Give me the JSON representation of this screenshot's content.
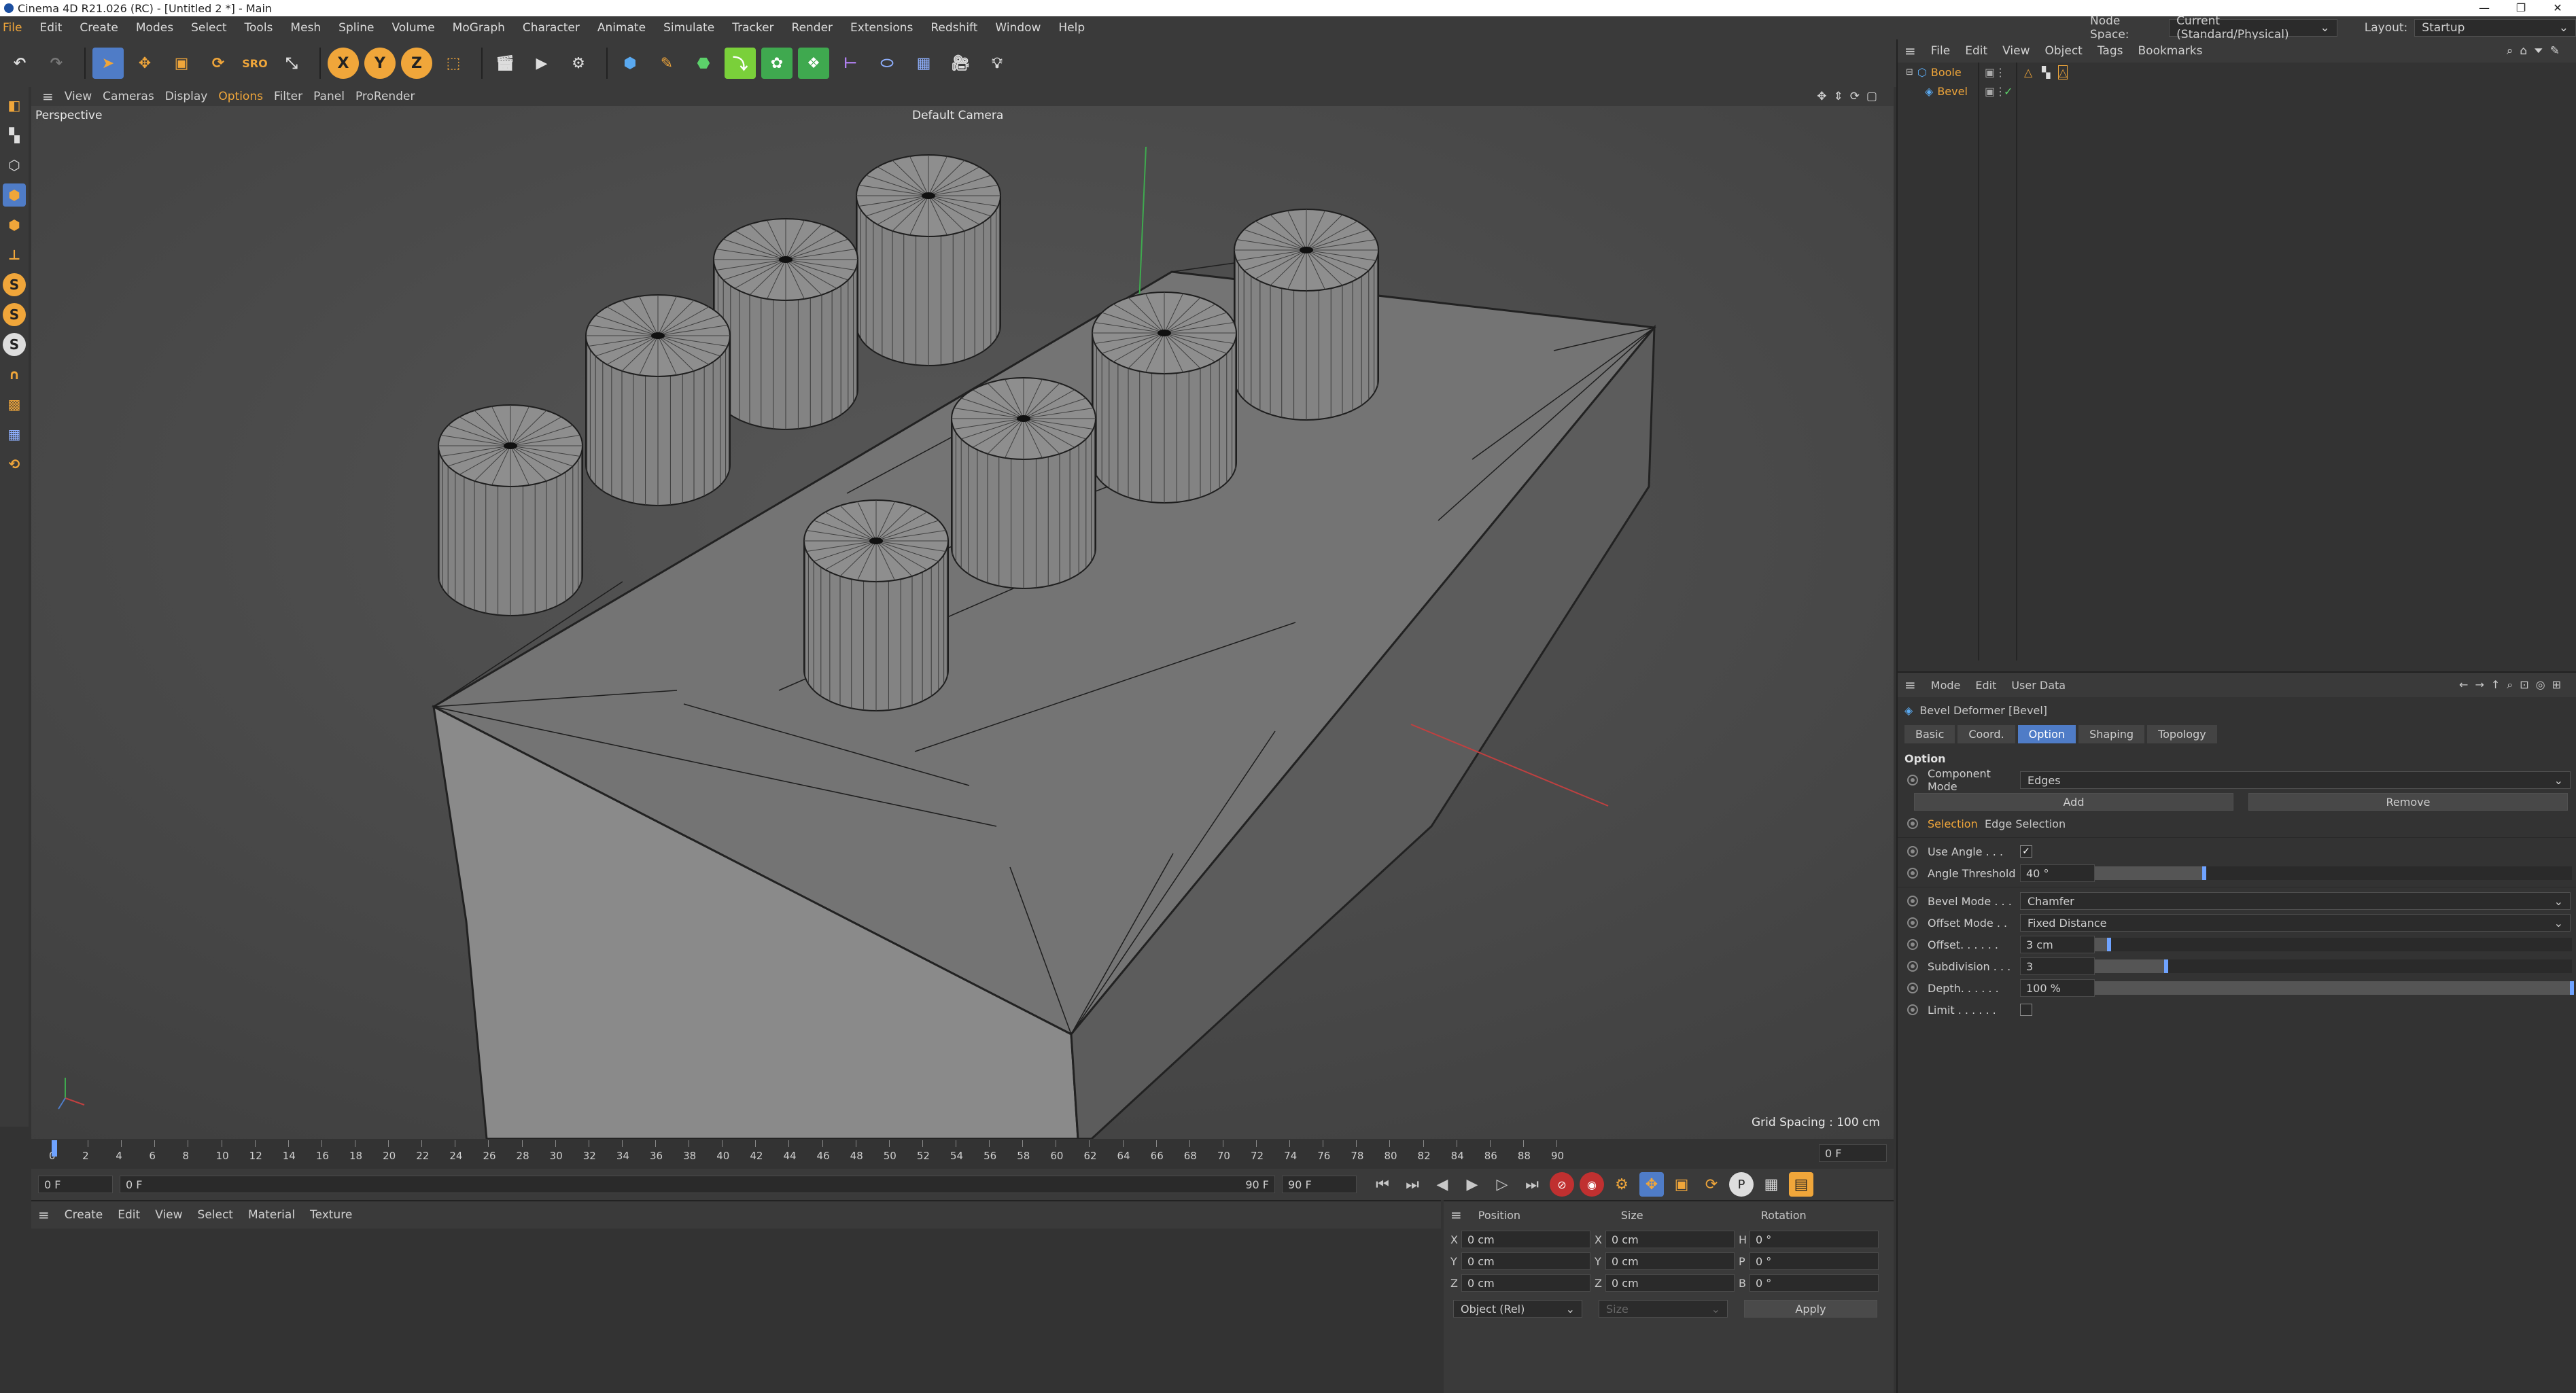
{
  "window": {
    "title": "Cinema 4D R21.026 (RC) - [Untitled 2 *] - Main",
    "controls": [
      "—",
      "❐",
      "✕"
    ]
  },
  "menubar": {
    "items": [
      "File",
      "Edit",
      "Create",
      "Modes",
      "Select",
      "Tools",
      "Mesh",
      "Spline",
      "Volume",
      "MoGraph",
      "Character",
      "Animate",
      "Simulate",
      "Tracker",
      "Render",
      "Extensions",
      "Redshift",
      "Window",
      "Help"
    ],
    "node_space_label": "Node Space:",
    "node_space_value": "Current (Standard/Physical)",
    "layout_label": "Layout:",
    "layout_value": "Startup"
  },
  "toolbar": {
    "axis_x": "X",
    "axis_y": "Y",
    "axis_z": "Z"
  },
  "viewport": {
    "menu": [
      "View",
      "Cameras",
      "Display",
      "Options",
      "Filter",
      "Panel",
      "ProRender"
    ],
    "view_name": "Perspective",
    "camera": "Default Camera",
    "grid_spacing": "Grid Spacing : 100 cm"
  },
  "timeline": {
    "ticks": [
      "0",
      "2",
      "4",
      "6",
      "8",
      "10",
      "12",
      "14",
      "16",
      "18",
      "20",
      "22",
      "24",
      "26",
      "28",
      "30",
      "32",
      "34",
      "36",
      "38",
      "40",
      "42",
      "44",
      "46",
      "48",
      "50",
      "52",
      "54",
      "56",
      "58",
      "60",
      "62",
      "64",
      "66",
      "68",
      "70",
      "72",
      "74",
      "76",
      "78",
      "80",
      "82",
      "84",
      "86",
      "88",
      "90"
    ],
    "current_frame": "0 F",
    "start_frame": "0 F",
    "min_frame": "0 F",
    "end_frame": "90 F",
    "max_frame": "90 F"
  },
  "material_manager": {
    "menu": [
      "Create",
      "Edit",
      "View",
      "Select",
      "Material",
      "Texture"
    ]
  },
  "coordinates": {
    "headers": {
      "position": "Position",
      "size": "Size",
      "rotation": "Rotation"
    },
    "rows": [
      {
        "axis": "X",
        "pos": "0 cm",
        "size_axis": "X",
        "size": "0 cm",
        "rot_axis": "H",
        "rot": "0 °"
      },
      {
        "axis": "Y",
        "pos": "0 cm",
        "size_axis": "Y",
        "size": "0 cm",
        "rot_axis": "P",
        "rot": "0 °"
      },
      {
        "axis": "Z",
        "pos": "0 cm",
        "size_axis": "Z",
        "size": "0 cm",
        "rot_axis": "B",
        "rot": "0 °"
      }
    ],
    "mode": "Object (Rel)",
    "size_mode": "Size",
    "apply": "Apply"
  },
  "object_manager": {
    "menu": [
      "File",
      "Edit",
      "View",
      "Object",
      "Tags",
      "Bookmarks"
    ],
    "objects": [
      {
        "name": "Boole",
        "color": "#f0a63a"
      },
      {
        "name": "Bevel",
        "color": "#f0a63a"
      }
    ]
  },
  "attributes": {
    "menu": [
      "Mode",
      "Edit",
      "User Data"
    ],
    "object_title": "Bevel Deformer [Bevel]",
    "tabs": [
      "Basic",
      "Coord.",
      "Option",
      "Shaping",
      "Topology"
    ],
    "active_tab": "Option",
    "section": "Option",
    "component_mode_label": "Component Mode",
    "component_mode_value": "Edges",
    "add_label": "Add",
    "remove_label": "Remove",
    "selection_label": "Selection",
    "selection_value": "Edge Selection",
    "use_angle_label": "Use Angle . . .",
    "use_angle_checked": true,
    "angle_threshold_label": "Angle Threshold",
    "angle_threshold_value": "40 °",
    "angle_threshold_fraction": 0.23,
    "bevel_mode_label": "Bevel Mode . . .",
    "bevel_mode_value": "Chamfer",
    "offset_mode_label": "Offset Mode . .",
    "offset_mode_value": "Fixed Distance",
    "offset_label": "Offset. . . . . .",
    "offset_value": "3 cm",
    "offset_fraction": 0.03,
    "subdivision_label": "Subdivision . . .",
    "subdivision_value": "3",
    "subdivision_fraction": 0.15,
    "depth_label": "Depth. . . . . .",
    "depth_value": "100 %",
    "depth_fraction": 1.0,
    "limit_label": "Limit . . . . . .",
    "limit_checked": false
  },
  "colors": {
    "accent_orange": "#f0a63a",
    "accent_blue": "#4f7cc7",
    "viewport_bg": "#4a4a4a"
  }
}
